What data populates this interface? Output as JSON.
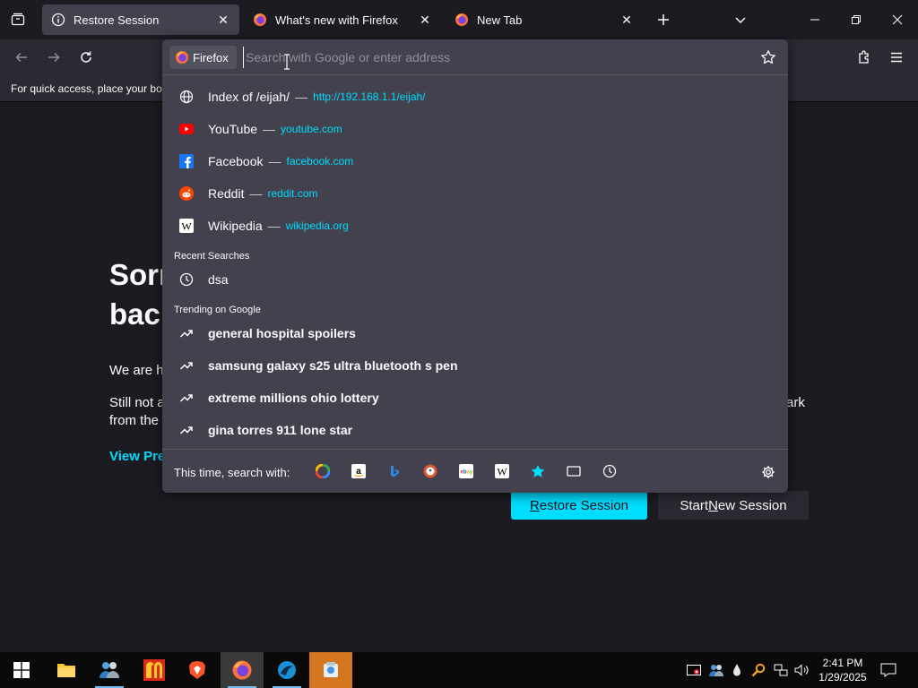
{
  "tabs": [
    {
      "title": "Restore Session",
      "active": true
    },
    {
      "title": "What's new with Firefox",
      "active": false
    },
    {
      "title": "New Tab",
      "active": false
    }
  ],
  "bookmarks_bar": {
    "text": "For quick access, place your boo"
  },
  "urlbar": {
    "identity_label": "Firefox",
    "placeholder": "Search with Google or enter address",
    "results": [
      {
        "title": "Index of /eijah/",
        "url": "http://192.168.1.1/eijah/",
        "icon": "globe-icon"
      },
      {
        "title": "YouTube",
        "url": "youtube.com",
        "icon": "youtube-icon"
      },
      {
        "title": "Facebook",
        "url": "facebook.com",
        "icon": "facebook-icon"
      },
      {
        "title": "Reddit",
        "url": "reddit.com",
        "icon": "reddit-icon"
      },
      {
        "title": "Wikipedia",
        "url": "wikipedia.org",
        "icon": "wikipedia-icon"
      }
    ],
    "separator": "—",
    "recent_label": "Recent Searches",
    "recent": [
      {
        "title": "dsa"
      }
    ],
    "trending_label": "Trending on Google",
    "trending": [
      {
        "title": "general hospital spoilers"
      },
      {
        "title": "samsung galaxy s25 ultra bluetooth s pen"
      },
      {
        "title": "extreme millions ohio lottery"
      },
      {
        "title": "gina torres 911 lone star"
      }
    ],
    "oneoff_label": "This time, search with:",
    "engines": [
      "google-icon",
      "amazon-icon",
      "bing-icon",
      "duckduckgo-icon",
      "ebay-icon",
      "wikipedia-icon",
      "bookmarks-icon",
      "tabs-icon",
      "history-icon"
    ]
  },
  "page": {
    "title_line1": "Sorr",
    "title_line2": "back",
    "p1": "We are h",
    "p2_start": "Still not a",
    "p2_end": "ark",
    "p2_line2": "from the",
    "link": "View Pre",
    "restore_button": {
      "pre": "",
      "u": "R",
      "post": "estore Session"
    },
    "new_session_button": {
      "pre": "Start ",
      "u": "N",
      "post": "ew Session"
    }
  },
  "taskbar": {
    "time": "2:41 PM",
    "date": "1/29/2025"
  },
  "colors": {
    "accent": "#00ddff",
    "toolbar": "#2b2a33",
    "panel": "#42414d",
    "background": "#1c1b22"
  }
}
